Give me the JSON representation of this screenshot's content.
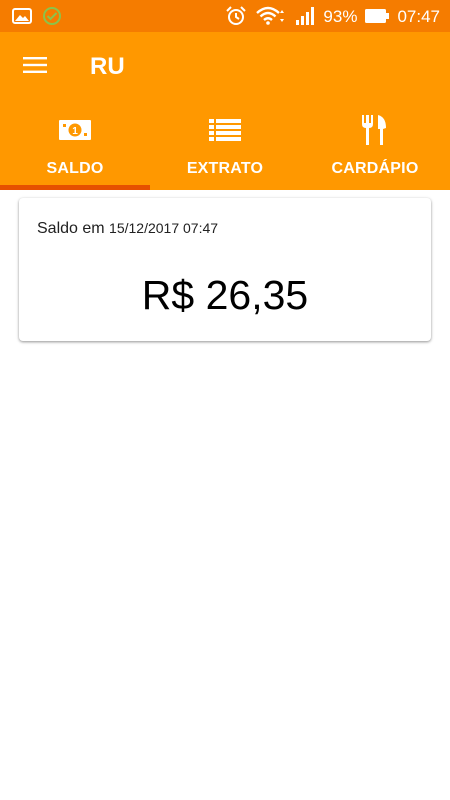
{
  "status_bar": {
    "battery_percent": "93%",
    "time": "07:47",
    "icons": [
      "gallery-icon",
      "check-circle-icon",
      "alarm-icon",
      "wifi-icon",
      "signal-icon",
      "battery-icon"
    ]
  },
  "app_bar": {
    "title": "RU",
    "menu_icon": "hamburger-menu-icon"
  },
  "tabs": [
    {
      "label": "SALDO",
      "icon": "money-bill-icon",
      "selected": true
    },
    {
      "label": "EXTRATO",
      "icon": "list-icon",
      "selected": false
    },
    {
      "label": "CARDÁPIO",
      "icon": "fork-knife-icon",
      "selected": false
    }
  ],
  "balance": {
    "label": "Saldo em",
    "date": "15/12/2017 07:47",
    "amount": "R$ 26,35"
  },
  "colors": {
    "status_bar": "#F57C00",
    "primary": "#FF9800",
    "tab_indicator": "#E65100"
  }
}
